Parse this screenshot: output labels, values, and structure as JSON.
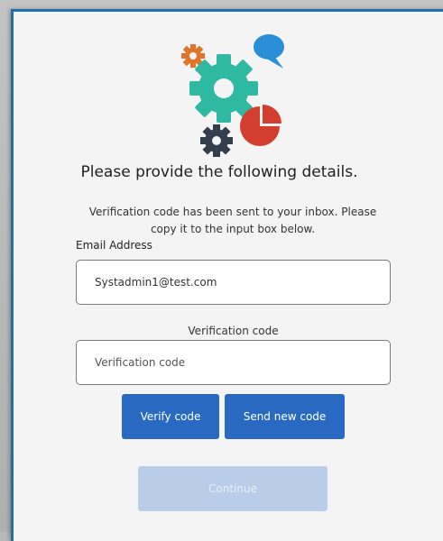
{
  "form": {
    "heading": "Please provide the following details.",
    "intro": "Verification code has been sent to your inbox. Please copy it to the input box below.",
    "email_label": "Email Address",
    "email_value": "Systadmin1@test.com",
    "code_label": "Verification code",
    "code_placeholder": "Verification code",
    "verify_button": "Verify code",
    "send_button": "Send new code",
    "continue_button": "Continue"
  },
  "colors": {
    "accent": "#2a69c2",
    "continue_disabled": "#b9cde8",
    "border_blue": "#1f6fb5",
    "logo_gear_teal": "#2fb9a3",
    "logo_gear_orange": "#e0752a",
    "logo_gear_dark": "#333f4d",
    "logo_bubble_blue": "#2a8fd6",
    "logo_pie_red": "#d23f2f"
  },
  "icons": {
    "logo": "gears-chat-pie-logo"
  }
}
